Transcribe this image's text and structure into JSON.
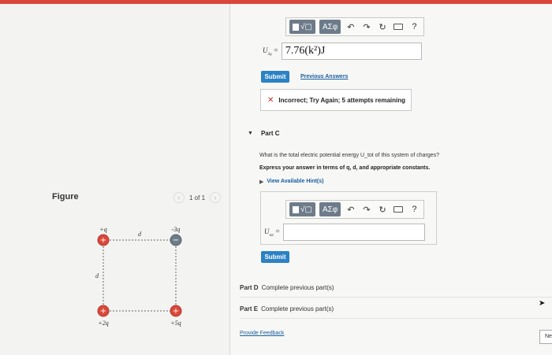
{
  "figure": {
    "title": "Figure",
    "pager": "1 of 1",
    "charges": {
      "top_left": "+q",
      "top_right": "-3q",
      "bottom_left": "+2q",
      "bottom_right": "+5q",
      "side_top": "d",
      "side_left": "d"
    }
  },
  "toolbar": {
    "templates_label": "√▢",
    "symbols_label": "ΑΣφ",
    "help_label": "?"
  },
  "part_b": {
    "var_label": "U",
    "var_sub": "3q",
    "answer_value": "7.76(k²)J",
    "submit_label": "Submit",
    "prev_answers_label": "Previous Answers",
    "feedback_text": "Incorrect; Try Again; 5 attempts remaining"
  },
  "part_c": {
    "title": "Part C",
    "question": "What is the total electric potential energy U_tot of this system of charges?",
    "instruction": "Express your answer in terms of q, d, and appropriate constants.",
    "hints_label": "View Available Hint(s)",
    "var_label": "U",
    "var_sub": "tot",
    "answer_value": "",
    "submit_label": "Submit"
  },
  "part_d": {
    "label": "Part D",
    "text": "Complete previous part(s)"
  },
  "part_e": {
    "label": "Part E",
    "text": "Complete previous part(s)"
  },
  "footer": {
    "feedback_link": "Provide Feedback",
    "next_label": "Ne"
  },
  "colors": {
    "accent": "#2b82c4",
    "error": "#c3352a",
    "positive": "#d9483b",
    "negative": "#6d7b8a"
  }
}
